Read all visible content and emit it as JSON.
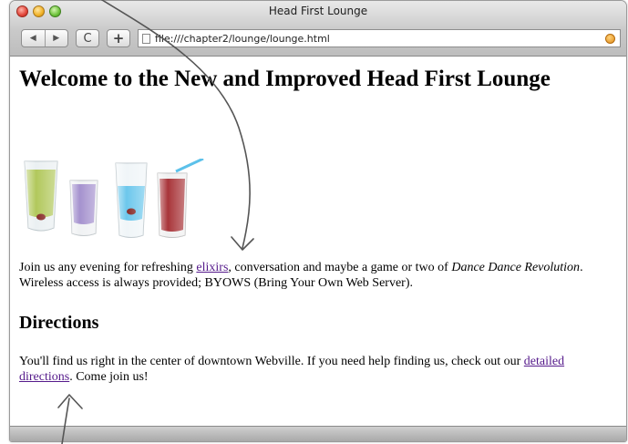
{
  "window": {
    "title": "Head First Lounge"
  },
  "toolbar": {
    "back_symbol": "◀",
    "forward_symbol": "▶",
    "reload_symbol": "C",
    "add_symbol": "+",
    "url": "file:///chapter2/lounge/lounge.html"
  },
  "page": {
    "heading": "Welcome to the New and Improved Head First Lounge",
    "intro": {
      "before_link": "Join us any evening for refreshing ",
      "link_text": "elixirs",
      "after_link": ", conversation and maybe a game or two of ",
      "emphasis": "Dance Dance Revolution",
      "closing": ". Wireless access is always provided; BYOWS (Bring Your Own Web Server)."
    },
    "directions_heading": "Directions",
    "directions": {
      "before_link": "You'll find us right in the center of downtown Webville. If you need help finding us, check out our ",
      "link_text": "detailed directions",
      "after_link": ". Come join us!"
    }
  },
  "image": {
    "semantic": "drinks-image",
    "glasses": [
      {
        "color": "#a9c24a"
      },
      {
        "color": "#9b86c9"
      },
      {
        "color": "#5cc1ea"
      },
      {
        "color": "#9f1f24"
      }
    ]
  },
  "colors": {
    "visited_link": "#551a8b",
    "window_chrome": "#c9c9c9"
  }
}
